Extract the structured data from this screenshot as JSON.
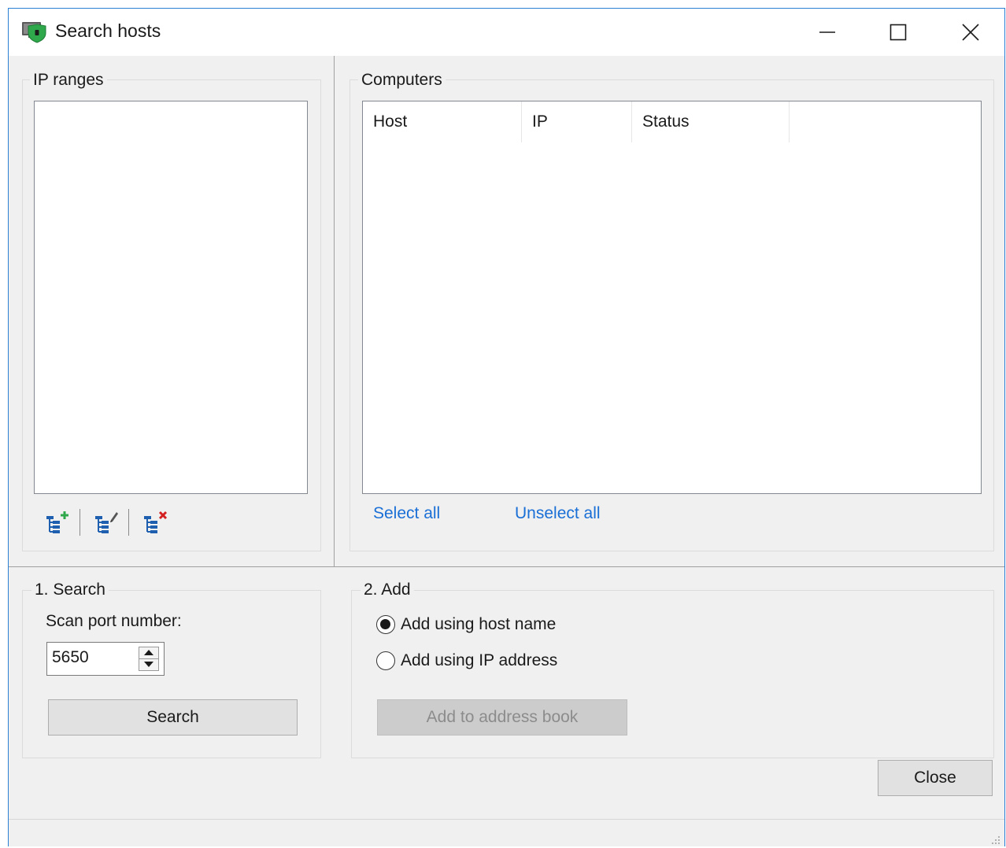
{
  "window": {
    "title": "Search hosts",
    "app_icon": "shield-monitor-icon",
    "controls": {
      "minimize": "minimize-icon",
      "maximize": "maximize-icon",
      "close": "close-icon"
    }
  },
  "ip_ranges": {
    "label": "IP ranges",
    "items": [],
    "toolbar": [
      {
        "name": "add-range",
        "icon": "tree-add-icon"
      },
      {
        "name": "edit-range",
        "icon": "tree-edit-icon"
      },
      {
        "name": "delete-range",
        "icon": "tree-delete-icon"
      }
    ]
  },
  "computers": {
    "label": "Computers",
    "columns": [
      "Host",
      "IP",
      "Status"
    ],
    "rows": [],
    "select_all": "Select all",
    "unselect_all": "Unselect all"
  },
  "search": {
    "label": "1. Search",
    "port_label": "Scan port number:",
    "port_value": "5650",
    "button": "Search"
  },
  "add": {
    "label": "2. Add",
    "options": [
      {
        "label": "Add using host name",
        "checked": true
      },
      {
        "label": "Add using IP address",
        "checked": false
      }
    ],
    "button": "Add to address book",
    "button_enabled": false
  },
  "close_button": "Close",
  "colors": {
    "accent_border": "#2b7fd4",
    "link": "#1a6fd6",
    "window_bg": "#f0f0f0",
    "icon_blue": "#1f5fb0",
    "icon_green": "#2ea84a",
    "icon_red": "#d42020"
  }
}
